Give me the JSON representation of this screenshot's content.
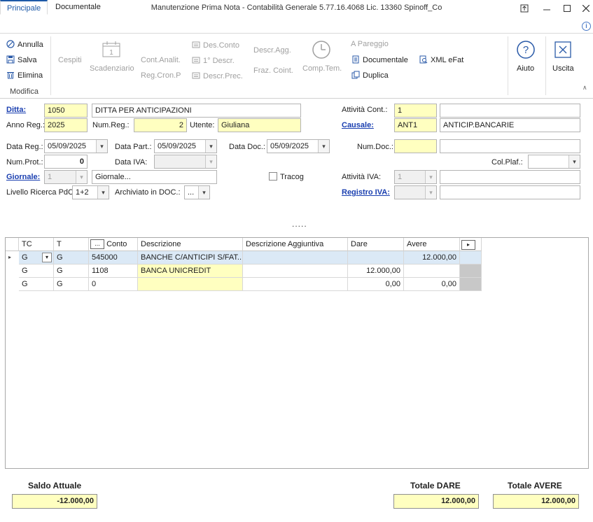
{
  "window": {
    "title": "Manutenzione Prima Nota - Contabilità Generale 5.77.16.4068 Lic. 13360 Spinoff_Co"
  },
  "tabs": [
    {
      "label": "Principale",
      "active": true
    },
    {
      "label": "Documentale",
      "active": false
    }
  ],
  "ribbon": {
    "modifica": {
      "annulla": "Annulla",
      "salva": "Salva",
      "elimina": "Elimina",
      "group_label": "Modifica"
    },
    "cespiti": "Cespiti",
    "scadenziario": "Scadenziario",
    "cont_analit": "Cont.Analit.",
    "reg_cron_p": "Reg.Cron.P",
    "des_conto": "Des.Conto",
    "primo_descr": "1° Descr.",
    "descr_prec": "Descr.Prec.",
    "descr_agg": "Descr.Agg.",
    "fraz_coint": "Fraz. Coint.",
    "comp_tem": "Comp.Tem.",
    "a_pareggio": "A Pareggio",
    "documentale": "Documentale",
    "duplica": "Duplica",
    "xml_efat": "XML eFat",
    "aiuto": "Aiuto",
    "uscita": "Uscita"
  },
  "form": {
    "ditta_label": "Ditta:",
    "ditta_code": "1050",
    "ditta_name": "DITTA PER ANTICIPAZIONI",
    "anno_reg_label": "Anno Reg.:",
    "anno_reg": "2025",
    "num_reg_label": "Num.Reg.:",
    "num_reg": "2",
    "utente_label": "Utente:",
    "utente": "Giuliana",
    "attivita_cont_label": "Attività Cont.:",
    "attivita_cont": "1",
    "attivita_cont_desc": "",
    "causale_label": "Causale:",
    "causale_code": "ANT1",
    "causale_desc": "ANTICIP.BANCARIE",
    "data_reg_label": "Data Reg.:",
    "data_reg": "05/09/2025",
    "data_part_label": "Data Part.:",
    "data_part": "05/09/2025",
    "data_doc_label": "Data Doc.:",
    "data_doc": "05/09/2025",
    "num_doc_label": "Num.Doc.:",
    "num_doc": "",
    "num_doc_ext": "",
    "num_prot_label": "Num.Prot.:",
    "num_prot": "0",
    "data_iva_label": "Data IVA:",
    "data_iva": "",
    "col_plaf_label": "Col.Plaf.:",
    "col_plaf": "",
    "giornale_label": "Giornale:",
    "giornale_code": "1",
    "giornale_desc": "Giornale...",
    "tracog_label": "Tracog",
    "attivita_iva_label": "Attività IVA:",
    "attivita_iva": "1",
    "attivita_iva_desc": "",
    "livello_label": "Livello Ricerca PdC:",
    "livello": "1+2",
    "archiviato_label": "Archiviato in DOC.:",
    "archiviato": "...",
    "registro_iva_label": "Registro IVA:",
    "registro_iva": "",
    "registro_iva_desc": "",
    "ellipsis": "....."
  },
  "grid": {
    "headers": {
      "tc": "TC",
      "t": "T",
      "conto_btn": "...",
      "conto": "Conto",
      "descrizione": "Descrizione",
      "descr_agg": "Descrizione Aggiuntiva",
      "dare": "Dare",
      "avere": "Avere"
    },
    "rows": [
      {
        "tc": "G",
        "t": "G",
        "conto": "545000",
        "descrizione": "BANCHE C/ANTICIPI S/FAT...",
        "descr_agg": "",
        "dare": "",
        "avere": "12.000,00"
      },
      {
        "tc": "G",
        "t": "G",
        "conto": "1108",
        "descrizione": "BANCA UNICREDIT",
        "descr_agg": "",
        "dare": "12.000,00",
        "avere": ""
      },
      {
        "tc": "G",
        "t": "G",
        "conto": "0",
        "descrizione": "",
        "descr_agg": "",
        "dare": "0,00",
        "avere": "0,00"
      }
    ]
  },
  "footer": {
    "saldo_label": "Saldo Attuale",
    "saldo": "-12.000,00",
    "totale_dare_label": "Totale DARE",
    "totale_dare": "12.000,00",
    "totale_avere_label": "Totale AVERE",
    "totale_avere": "12.000,00"
  },
  "colors": {
    "accent": "#1e5aa8",
    "field_yellow": "#ffffc0",
    "selected_row": "#dbe9f6"
  }
}
